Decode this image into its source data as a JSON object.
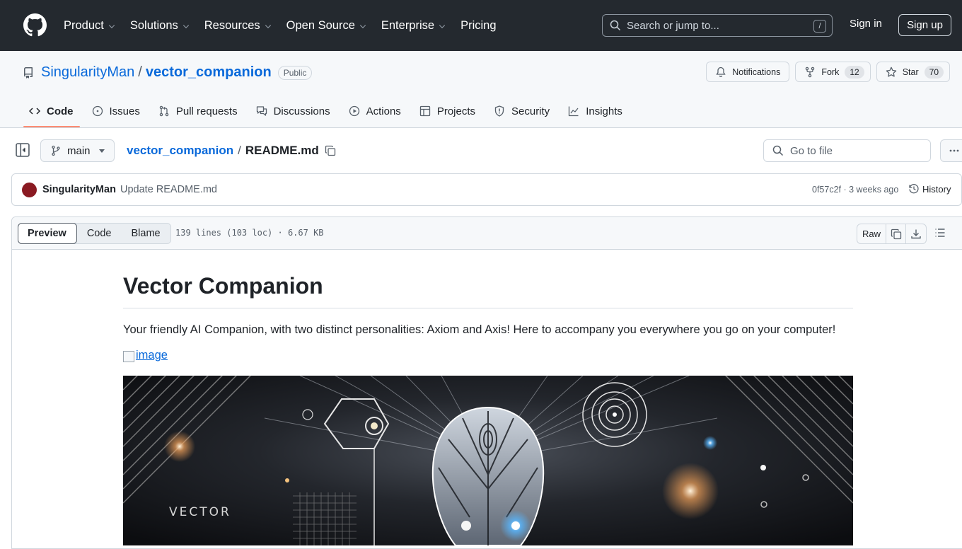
{
  "header": {
    "nav": [
      "Product",
      "Solutions",
      "Resources",
      "Open Source",
      "Enterprise",
      "Pricing"
    ],
    "search_placeholder": "Search or jump to...",
    "search_shortcut": "/",
    "sign_in": "Sign in",
    "sign_up": "Sign up"
  },
  "repo": {
    "owner": "SingularityMan",
    "separator": "/",
    "name": "vector_companion",
    "visibility": "Public",
    "notifications_label": "Notifications",
    "fork_label": "Fork",
    "fork_count": "12",
    "star_label": "Star",
    "star_count": "70",
    "tabs": [
      "Code",
      "Issues",
      "Pull requests",
      "Discussions",
      "Actions",
      "Projects",
      "Security",
      "Insights"
    ]
  },
  "filebar": {
    "branch": "main",
    "root": "vector_companion",
    "separator": "/",
    "file": "README.md",
    "goto_placeholder": "Go to file"
  },
  "commit": {
    "author": "SingularityMan",
    "message": "Update README.md",
    "meta": "0f57c2f · 3 weeks ago",
    "history_label": "History"
  },
  "fileview": {
    "modes": [
      "Preview",
      "Code",
      "Blame"
    ],
    "info": "139 lines (103 loc) · 6.67 KB",
    "raw_label": "Raw"
  },
  "readme": {
    "title": "Vector Companion",
    "description": "Your friendly AI Companion, with two distinct personalities: Axiom and Axis! Here to accompany you everywhere you go on your computer!",
    "image_alt": "image",
    "hero_text": "VECTOR"
  },
  "colors": {
    "header_bg": "#24292f",
    "link": "#0969da",
    "tab_underline": "#fd8c73",
    "avatar": "#8a1a22"
  }
}
